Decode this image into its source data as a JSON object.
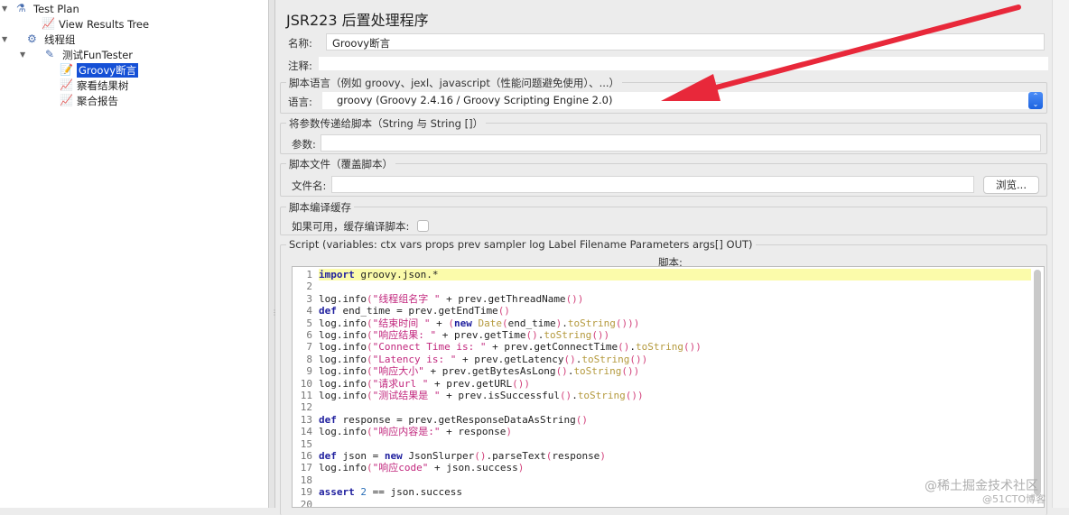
{
  "tree": [
    {
      "label": "Test Plan",
      "icon": "flask-icon",
      "selected": false
    },
    {
      "label": "View Results Tree",
      "icon": "chart-icon",
      "selected": false
    },
    {
      "label": "线程组",
      "icon": "gear-icon",
      "selected": false
    },
    {
      "label": "测试FunTester",
      "icon": "pipette-icon",
      "selected": false
    },
    {
      "label": "Groovy断言",
      "icon": "script-icon",
      "selected": true
    },
    {
      "label": "察看结果树",
      "icon": "chart-icon",
      "selected": false
    },
    {
      "label": "聚合报告",
      "icon": "chart-icon",
      "selected": false
    }
  ],
  "panel": {
    "title": "JSR223 后置处理程序",
    "name_label": "名称:",
    "name_value": "Groovy断言",
    "comment_label": "注释:",
    "comment_value": "",
    "lang_group": "脚本语言（例如 groovy、jexl、javascript（性能问题避免使用）、...）",
    "lang_label": "语言:",
    "lang_value": "groovy     (Groovy 2.4.16 / Groovy Scripting Engine 2.0)",
    "params_group": "将参数传递给脚本（String 与 String []）",
    "params_label": "参数:",
    "params_value": "",
    "file_group": "脚本文件（覆盖脚本）",
    "file_label": "文件名:",
    "file_value": "",
    "browse_label": "浏览...",
    "cache_group": "脚本编译缓存",
    "cache_label": "如果可用，缓存编译脚本:",
    "cache_checked": false,
    "script_group": "Script (variables: ctx vars props prev sampler log Label Filename Parameters args[] OUT)",
    "script_label": "脚本:"
  },
  "colors": {
    "selection": "#1550d6",
    "current_line": "#fbfbaa",
    "keyword": "#1f1f9e",
    "string": "#c2287e",
    "arrow": "#e8283a"
  },
  "code": [
    [
      [
        "import",
        "kw"
      ],
      [
        " groovy.json.*",
        "p"
      ]
    ],
    [],
    [
      [
        "log.info",
        "p"
      ],
      [
        "(",
        "paren"
      ],
      [
        "\"线程组名字 \"",
        "str"
      ],
      [
        " + prev.getThreadName",
        "p"
      ],
      [
        "())",
        "paren"
      ]
    ],
    [
      [
        "def",
        "kw"
      ],
      [
        " end_time = prev.getEndTime",
        "p"
      ],
      [
        "()",
        "paren"
      ]
    ],
    [
      [
        "log.info",
        "p"
      ],
      [
        "(",
        "paren"
      ],
      [
        "\"结束时间 \"",
        "str"
      ],
      [
        " + ",
        "p"
      ],
      [
        "(",
        "paren"
      ],
      [
        "new",
        "kw"
      ],
      [
        " ",
        "p"
      ],
      [
        "Date",
        "meth"
      ],
      [
        "(",
        "paren"
      ],
      [
        "end_time",
        "p"
      ],
      [
        ")",
        "paren"
      ],
      [
        ".",
        "p"
      ],
      [
        "toString",
        "meth"
      ],
      [
        "()))",
        "paren"
      ]
    ],
    [
      [
        "log.info",
        "p"
      ],
      [
        "(",
        "paren"
      ],
      [
        "\"响应结果: \"",
        "str"
      ],
      [
        " + prev.getTime",
        "p"
      ],
      [
        "()",
        "paren"
      ],
      [
        ".",
        "p"
      ],
      [
        "toString",
        "meth"
      ],
      [
        "())",
        "paren"
      ]
    ],
    [
      [
        "log.info",
        "p"
      ],
      [
        "(",
        "paren"
      ],
      [
        "\"Connect Time is: \"",
        "str"
      ],
      [
        " + prev.getConnectTime",
        "p"
      ],
      [
        "()",
        "paren"
      ],
      [
        ".",
        "p"
      ],
      [
        "toString",
        "meth"
      ],
      [
        "())",
        "paren"
      ]
    ],
    [
      [
        "log.info",
        "p"
      ],
      [
        "(",
        "paren"
      ],
      [
        "\"Latency is: \"",
        "str"
      ],
      [
        " + prev.getLatency",
        "p"
      ],
      [
        "()",
        "paren"
      ],
      [
        ".",
        "p"
      ],
      [
        "toString",
        "meth"
      ],
      [
        "())",
        "paren"
      ]
    ],
    [
      [
        "log.info",
        "p"
      ],
      [
        "(",
        "paren"
      ],
      [
        "\"响应大小\"",
        "str"
      ],
      [
        " + prev.getBytesAsLong",
        "p"
      ],
      [
        "()",
        "paren"
      ],
      [
        ".",
        "p"
      ],
      [
        "toString",
        "meth"
      ],
      [
        "())",
        "paren"
      ]
    ],
    [
      [
        "log.info",
        "p"
      ],
      [
        "(",
        "paren"
      ],
      [
        "\"请求url \"",
        "str"
      ],
      [
        " + prev.getURL",
        "p"
      ],
      [
        "())",
        "paren"
      ]
    ],
    [
      [
        "log.info",
        "p"
      ],
      [
        "(",
        "paren"
      ],
      [
        "\"测试结果是 \"",
        "str"
      ],
      [
        " + prev.isSuccessful",
        "p"
      ],
      [
        "()",
        "paren"
      ],
      [
        ".",
        "p"
      ],
      [
        "toString",
        "meth"
      ],
      [
        "())",
        "paren"
      ]
    ],
    [],
    [
      [
        "def",
        "kw"
      ],
      [
        " response = prev.getResponseDataAsString",
        "p"
      ],
      [
        "()",
        "paren"
      ]
    ],
    [
      [
        "log.info",
        "p"
      ],
      [
        "(",
        "paren"
      ],
      [
        "\"响应内容是:\"",
        "str"
      ],
      [
        " + response",
        "p"
      ],
      [
        ")",
        "paren"
      ]
    ],
    [],
    [
      [
        "def",
        "kw"
      ],
      [
        " json = ",
        "p"
      ],
      [
        "new",
        "kw"
      ],
      [
        " JsonSlurper",
        "p"
      ],
      [
        "()",
        "paren"
      ],
      [
        ".parseText",
        "p"
      ],
      [
        "(",
        "paren"
      ],
      [
        "response",
        "p"
      ],
      [
        ")",
        "paren"
      ]
    ],
    [
      [
        "log.info",
        "p"
      ],
      [
        "(",
        "paren"
      ],
      [
        "\"响应code\"",
        "str"
      ],
      [
        " + json.success",
        "p"
      ],
      [
        ")",
        "paren"
      ]
    ],
    [],
    [
      [
        "assert",
        "kw"
      ],
      [
        " ",
        "p"
      ],
      [
        "2",
        "num"
      ],
      [
        " == json.success",
        "p"
      ]
    ],
    []
  ],
  "watermark": [
    "@稀土掘金技术社区",
    "@51CTO博客"
  ]
}
